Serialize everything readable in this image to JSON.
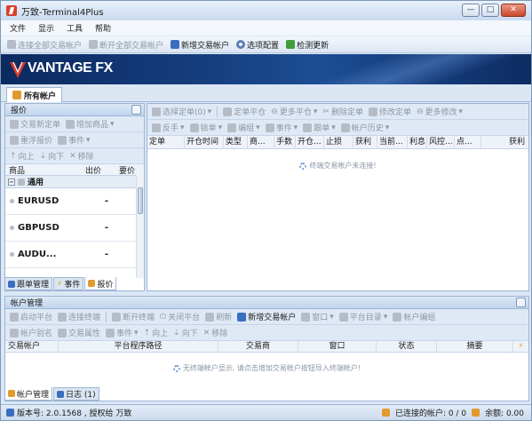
{
  "window": {
    "title": "万致-Terminal4Plus",
    "min": "—",
    "max": "□",
    "close": "✕"
  },
  "menu": [
    "文件",
    "显示",
    "工具",
    "帮助"
  ],
  "main_toolbar": {
    "connect_all": "连接全部交易帐户",
    "new_all": "断开全部交易帐户",
    "new_account": "新增交易帐户",
    "options": "选项配置",
    "check_update": "检测更新"
  },
  "banner": {
    "logo": "VANTAGE FX"
  },
  "account_tab": "所有帐户",
  "quote_panel": {
    "title": "报价",
    "tools_row1": [
      "交易新定单",
      "增加商品"
    ],
    "tools_row2": [
      "重浮报价",
      "事件"
    ],
    "tools_row3": [
      "向上",
      "向下",
      "移除"
    ],
    "columns": [
      "商品",
      "出价",
      "要价"
    ],
    "group": "通用",
    "rows": [
      {
        "symbol": "EURUSD",
        "bid": "-",
        "ask": "-"
      },
      {
        "symbol": "GBPUSD",
        "bid": "-",
        "ask": "-"
      },
      {
        "symbol": "AUDU...",
        "bid": "-",
        "ask": "-"
      }
    ],
    "tabs": [
      "跟单管理",
      "事件",
      "报价"
    ]
  },
  "orders_panel": {
    "tools_row1": [
      "选择定单(0)",
      "定单平仓",
      "更多平仓",
      "删除定单",
      "修改定单",
      "更多修改"
    ],
    "tools_row2": [
      "反手",
      "锁单",
      "编组",
      "事件",
      "跟单",
      "帐户历史"
    ],
    "columns": [
      "定单",
      "开仓时间",
      "类型",
      "商...",
      "手数",
      "开仓...",
      "止损",
      "获利",
      "当前...",
      "利息",
      "风控...",
      "点...",
      "获利"
    ],
    "empty": "终端交易帐户未连接!"
  },
  "account_mgr": {
    "title": "帐户管理",
    "tools_row1": [
      "启动平台",
      "连接终端",
      "断开终端",
      "关闭平台",
      "刷新",
      "新增交易帐户",
      "窗口",
      "平台目录",
      "帐户编组"
    ],
    "tools_row2": [
      "帐户别名",
      "交易属性",
      "事件",
      "向上",
      "向下",
      "移除"
    ],
    "columns": [
      "交易帐户",
      "平台程序路径",
      "交易商",
      "窗口",
      "状态",
      "摘要",
      "⚡"
    ],
    "empty": "无终端帐户显示, 请点击增加交易帐户按钮导入终端帐户!",
    "tabs": [
      "帐户管理",
      "日志 (1)"
    ]
  },
  "status": {
    "version": "版本号: 2.0.1568 , 授权给 万致",
    "connected": "已连接的帐户: 0 / 0",
    "balance": "余额: 0.00"
  }
}
